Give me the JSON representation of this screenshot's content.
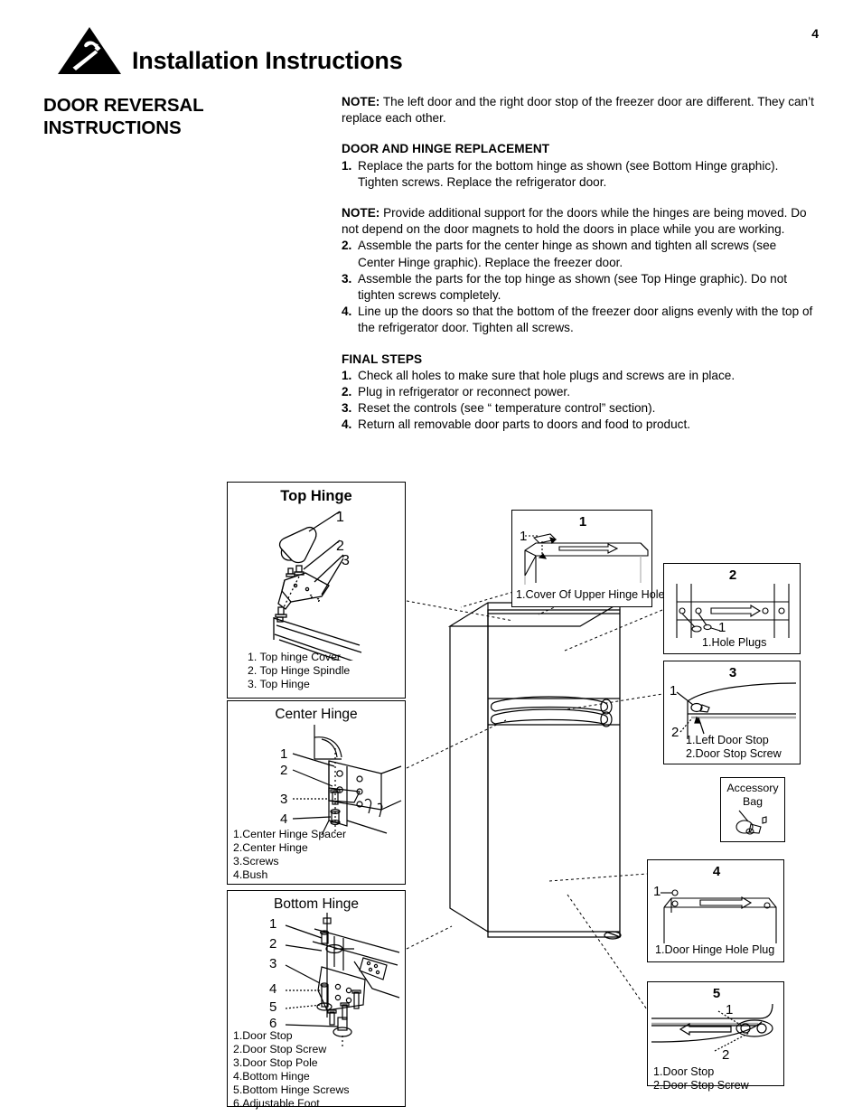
{
  "header": {
    "title": "Installation Instructions",
    "page_number": "4",
    "icon": "hazard-triangle-hammer-icon"
  },
  "section": {
    "heading_line1": "DOOR REVERSAL",
    "heading_line2": "INSTRUCTIONS"
  },
  "instructions": {
    "note1_label": "NOTE:",
    "note1_text": "The left door and the right door stop of the freezer door are different. They can’t replace each other.",
    "subhead1": "DOOR AND HINGE REPLACEMENT",
    "step1_num": "1.",
    "step1_text": "Replace the parts for the bottom hinge as shown (see Bottom Hinge graphic). Tighten screws. Replace the refrigerator door.",
    "note2_label": "NOTE:",
    "note2_text": "Provide additional support for the doors while the hinges are being moved. Do not depend on the door magnets to hold the doors in place while you are working.",
    "step2_num": "2.",
    "step2_text": "Assemble the parts for the center hinge as shown and tighten all screws (see Center Hinge graphic). Replace the freezer door.",
    "step3_num": "3.",
    "step3_text": "Assemble the parts for the top hinge as shown (see Top Hinge graphic). Do not tighten screws completely.",
    "step4_num": "4.",
    "step4_text": "Line up the doors so that the bottom of the freezer door aligns evenly with the top of the refrigerator door. Tighten all screws.",
    "subhead2": "FINAL STEPS",
    "final1_num": "1.",
    "final1_text": "Check all holes to make sure that hole plugs and screws are in place.",
    "final2_num": "2.",
    "final2_text": "Plug in refrigerator or reconnect power.",
    "final3_num": "3.",
    "final3_text": "Reset the controls (see “ temperature control” section).",
    "final4_num": "4.",
    "final4_text": "Return all removable door parts to doors and food to product."
  },
  "figures": {
    "top_hinge": {
      "title": "Top Hinge",
      "markers": [
        "1",
        "2",
        "3"
      ],
      "legend": [
        "1. Top hinge Cover",
        "2. Top Hinge Spindle",
        "3. Top Hinge"
      ]
    },
    "center_hinge": {
      "title": "Center Hinge",
      "markers": [
        "1",
        "2",
        "3",
        "4"
      ],
      "legend": [
        "1.Center Hinge Spacer",
        "2.Center Hinge",
        "3.Screws",
        "4.Bush"
      ]
    },
    "bottom_hinge": {
      "title": "Bottom Hinge",
      "markers": [
        "1",
        "2",
        "3",
        "4",
        "5",
        "6"
      ],
      "legend": [
        "1.Door Stop",
        "2.Door Stop Screw",
        "3.Door Stop Pole",
        "4.Bottom Hinge",
        "5.Bottom Hinge Screws",
        "6.Adjustable Foot"
      ]
    },
    "callout1": {
      "number": "1",
      "marker": "1",
      "caption": "1.Cover Of Upper Hinge Hole"
    },
    "callout2": {
      "number": "2",
      "marker": "1",
      "caption": "1.Hole Plugs"
    },
    "callout3": {
      "number": "3",
      "marker_1": "1",
      "marker_2": "2",
      "caption_line1": "1.Left Door Stop",
      "caption_line2": "2.Door Stop Screw"
    },
    "accessory_bag": {
      "title_line1": "Accessory",
      "title_line2": "Bag"
    },
    "callout4": {
      "number": "4",
      "marker": "1",
      "caption": "1.Door Hinge Hole Plug"
    },
    "callout5": {
      "number": "5",
      "marker_1": "1",
      "marker_2": "2",
      "caption_line1": "1.Door Stop",
      "caption_line2": "2.Door Stop Screw"
    },
    "refrigerator": {
      "name": "refrigerator-line-drawing"
    }
  }
}
